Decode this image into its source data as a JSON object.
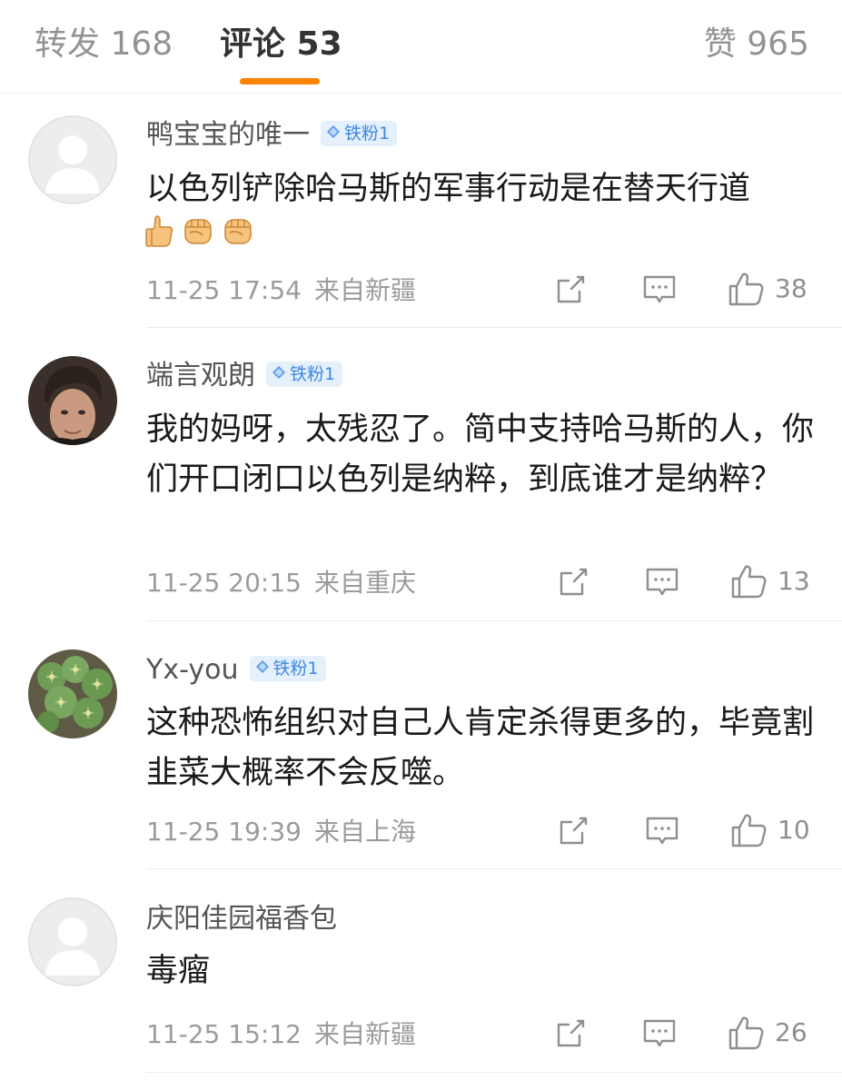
{
  "tabs": {
    "repost": "转发 168",
    "comments": "评论 53",
    "likes": "赞 965"
  },
  "colors": {
    "accent": "#ff8200",
    "badge_bg": "#e5f0fd",
    "badge_text": "#3d87e3"
  },
  "comments": [
    {
      "username": "鸭宝宝的唯一",
      "badge": "铁粉1",
      "text": "以色列铲除哈马斯的军事行动是在替天行道",
      "emojis": [
        "thumbs-up-icon",
        "fist-icon",
        "fist-icon"
      ],
      "time": "11-25 17:54",
      "location": "来自新疆",
      "likes": "38",
      "avatar": "default-avatar"
    },
    {
      "username": "端言观朗",
      "badge": "铁粉1",
      "text": "我的妈呀，太残忍了。简中支持哈马斯的人，你们开口闭口以色列是纳粹，到底谁才是纳粹？",
      "time": "11-25 20:15",
      "location": "来自重庆",
      "likes": "13",
      "avatar": "portrait-avatar"
    },
    {
      "username": "Yx-you",
      "badge": "铁粉1",
      "text": "这种恐怖组织对自己人肯定杀得更多的，毕竟割韭菜大概率不会反噬。",
      "time": "11-25 19:39",
      "location": "来自上海",
      "likes": "10",
      "avatar": "cactus-avatar"
    },
    {
      "username": "庆阳佳园福香包",
      "text": "毒瘤",
      "time": "11-25 15:12",
      "location": "来自新疆",
      "likes": "26",
      "avatar": "default-avatar"
    }
  ]
}
